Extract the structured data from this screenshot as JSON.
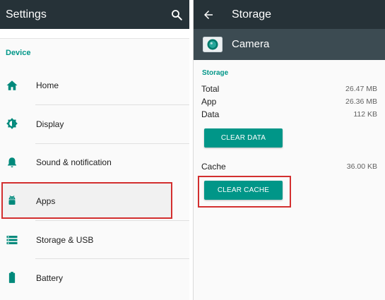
{
  "settings": {
    "title": "Settings",
    "section": "Device",
    "items": [
      {
        "label": "Home",
        "icon": "home-icon"
      },
      {
        "label": "Display",
        "icon": "display-brightness-icon"
      },
      {
        "label": "Sound & notification",
        "icon": "bell-icon"
      },
      {
        "label": "Apps",
        "icon": "android-icon"
      },
      {
        "label": "Storage & USB",
        "icon": "storage-icon"
      },
      {
        "label": "Battery",
        "icon": "battery-icon"
      }
    ]
  },
  "storage": {
    "title": "Storage",
    "app_name": "Camera",
    "section": "Storage",
    "rows": [
      {
        "label": "Total",
        "value": "26.47 MB"
      },
      {
        "label": "App",
        "value": "26.36 MB"
      },
      {
        "label": "Data",
        "value": "112 KB"
      }
    ],
    "clear_data_label": "CLEAR DATA",
    "cache": {
      "label": "Cache",
      "value": "36.00 KB"
    },
    "clear_cache_label": "CLEAR CACHE"
  },
  "colors": {
    "appbar": "#263238",
    "app_header": "#3c4b52",
    "accent": "#009688",
    "highlight_border": "#d32f2f"
  }
}
